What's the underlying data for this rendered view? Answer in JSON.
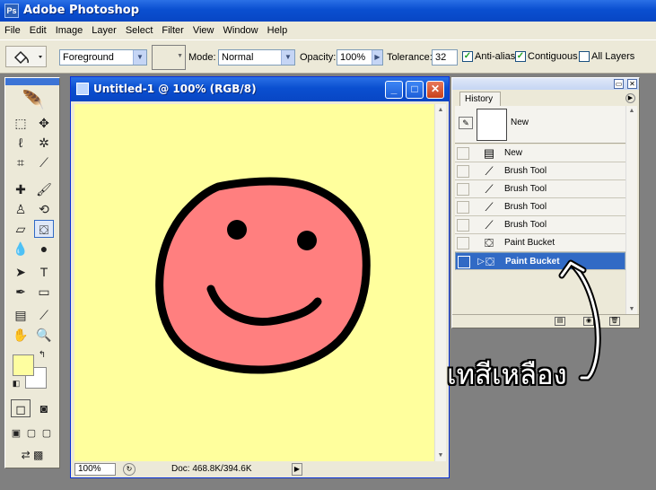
{
  "app": {
    "title": "Adobe Photoshop"
  },
  "menu": [
    "File",
    "Edit",
    "Image",
    "Layer",
    "Select",
    "Filter",
    "View",
    "Window",
    "Help"
  ],
  "options": {
    "fill_value": "Foreground",
    "mode_label": "Mode:",
    "mode_value": "Normal",
    "opacity_label": "Opacity:",
    "opacity_value": "100%",
    "tolerance_label": "Tolerance:",
    "tolerance_value": "32",
    "antialias_label": "Anti-alias",
    "contiguous_label": "Contiguous",
    "all_layers_label": "All Layers",
    "antialias_checked": true,
    "contiguous_checked": true,
    "all_layers_checked": false
  },
  "document": {
    "title": "Untitled-1 @ 100% (RGB/8)",
    "zoom": "100%",
    "doc_info": "Doc: 468.8K/394.6K",
    "canvas_color": "#ffff9d",
    "face_color": "#ff7f7f"
  },
  "colors": {
    "foreground": "#fefea0",
    "background": "#ffffff",
    "accent": "#316ac5"
  },
  "history": {
    "tab": "History",
    "snapshot": "New",
    "items": [
      {
        "label": "New",
        "icon": "new-document-icon"
      },
      {
        "label": "Brush Tool",
        "icon": "brush-icon"
      },
      {
        "label": "Brush Tool",
        "icon": "brush-icon"
      },
      {
        "label": "Brush Tool",
        "icon": "brush-icon"
      },
      {
        "label": "Brush Tool",
        "icon": "brush-icon"
      },
      {
        "label": "Paint Bucket",
        "icon": "paint-bucket-icon"
      },
      {
        "label": "Paint Bucket",
        "icon": "paint-bucket-icon"
      }
    ],
    "selected_index": 6
  },
  "annotation": {
    "text": "เทสีเหลือง"
  }
}
